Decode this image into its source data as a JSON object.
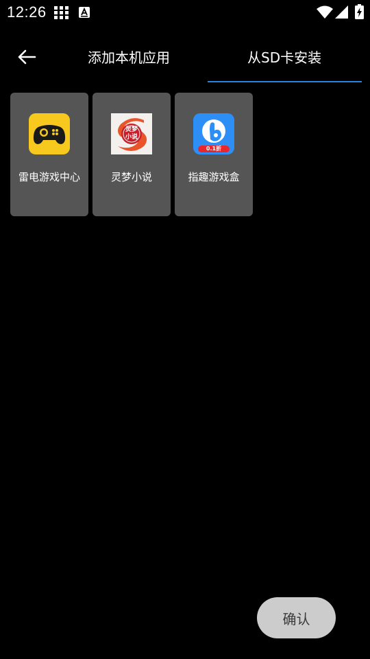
{
  "status_bar": {
    "time": "12:26",
    "icons": [
      "grid-notification-icon",
      "a-letter-notification-icon",
      "wifi-icon",
      "signal-icon",
      "battery-charging-icon"
    ]
  },
  "header": {
    "back_icon": "arrow-left-icon",
    "tabs": [
      {
        "label": "添加本机应用",
        "selected": false
      },
      {
        "label": "从SD卡安装",
        "selected": true
      }
    ],
    "accent_color": "#2a82e4"
  },
  "apps": [
    {
      "label": "雷电游戏中心",
      "icon": "gamepad-icon",
      "icon_color": "#f7c81e"
    },
    {
      "label": "灵梦小说",
      "icon": "lingmeng-novel-icon",
      "icon_text": "灵梦小说",
      "icon_color": "#e8552b"
    },
    {
      "label": "指趣游戏盒",
      "icon": "zhiqu-game-box-icon",
      "icon_badge": "0.1折",
      "icon_color": "#2d8ff5"
    }
  ],
  "footer": {
    "confirm_label": "确认"
  }
}
